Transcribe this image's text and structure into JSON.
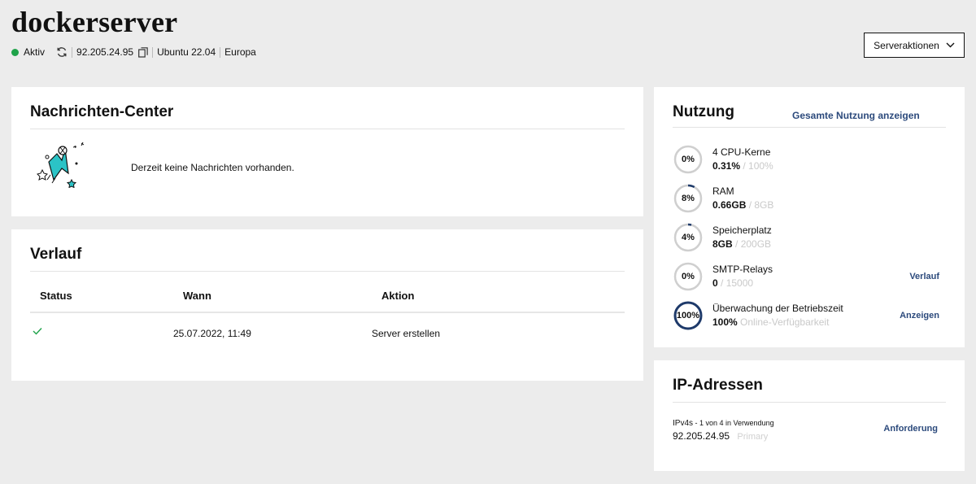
{
  "server": {
    "name": "dockerserver",
    "status": "Aktiv",
    "status_color": "#1fa34a",
    "ip": "92.205.24.95",
    "os": "Ubuntu 22.04",
    "region": "Europa"
  },
  "actions_button": {
    "label": "Serveraktionen",
    "icon": "chevron-down-icon"
  },
  "messages": {
    "title": "Nachrichten-Center",
    "empty_text": "Derzeit keine Nachrichten vorhanden."
  },
  "history": {
    "title": "Verlauf",
    "columns": [
      "Status",
      "Wann",
      "Aktion"
    ],
    "rows": [
      {
        "status_icon": "checkmark-icon",
        "when": "25.07.2022, 11:49",
        "action": "Server erstellen"
      }
    ]
  },
  "usage": {
    "title": "Nutzung",
    "link": "Gesamte Nutzung anzeigen",
    "accent": "#1e3a6a",
    "items": [
      {
        "percent": 0,
        "percent_label": "0%",
        "name": "4 CPU-Kerne",
        "value": "0.31%",
        "max": " / 100%",
        "link": ""
      },
      {
        "percent": 8,
        "percent_label": "8%",
        "name": "RAM",
        "value": "0.66GB",
        "max": " / 8GB",
        "link": ""
      },
      {
        "percent": 4,
        "percent_label": "4%",
        "name": "Speicherplatz",
        "value": "8GB",
        "max": " / 200GB",
        "link": ""
      },
      {
        "percent": 0,
        "percent_label": "0%",
        "name": "SMTP-Relays",
        "value": "0",
        "max": " / 15000",
        "link": "Verlauf"
      },
      {
        "percent": 100,
        "percent_label": "100%",
        "name": "Überwachung der Betriebszeit",
        "value": "100%",
        "max": " Online-Verfügbarkeit",
        "link": "Anzeigen"
      }
    ]
  },
  "ip_addresses": {
    "title": "IP-Adressen",
    "type_label": "IPv4s",
    "usage_text": " - 1 von 4 in Verwendung",
    "address": "92.205.24.95",
    "tag": "Primary",
    "link": "Anforderung"
  }
}
